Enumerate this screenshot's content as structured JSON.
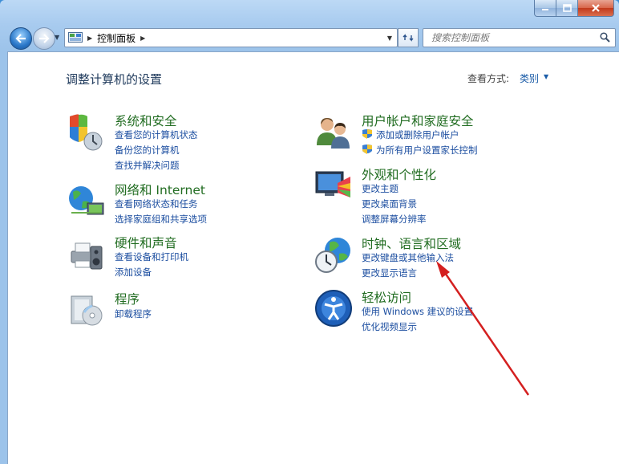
{
  "window": {
    "colors": {
      "accent": "#1c4ea0",
      "category_title": "#226d22",
      "annotation_arrow": "#d42020"
    }
  },
  "caption": {
    "minimize": "minimize",
    "maximize": "maximize",
    "close": "close"
  },
  "address": {
    "location": "控制面板",
    "icon": "control-panel-icon"
  },
  "search": {
    "placeholder": "搜索控制面板"
  },
  "header": {
    "title": "调整计算机的设置",
    "view_by_label": "查看方式:",
    "view_by_value": "类别"
  },
  "categories": {
    "system": {
      "title": "系统和安全",
      "links": [
        "查看您的计算机状态",
        "备份您的计算机",
        "查找并解决问题"
      ]
    },
    "network": {
      "title": "网络和 Internet",
      "links": [
        "查看网络状态和任务",
        "选择家庭组和共享选项"
      ]
    },
    "hardware": {
      "title": "硬件和声音",
      "links": [
        "查看设备和打印机",
        "添加设备"
      ]
    },
    "programs": {
      "title": "程序",
      "links": [
        "卸载程序"
      ]
    },
    "accounts": {
      "title": "用户帐户和家庭安全",
      "links": [
        "添加或删除用户帐户",
        "为所有用户设置家长控制"
      ]
    },
    "appearance": {
      "title": "外观和个性化",
      "links": [
        "更改主题",
        "更改桌面背景",
        "调整屏幕分辨率"
      ]
    },
    "clock": {
      "title": "时钟、语言和区域",
      "links": [
        "更改键盘或其他输入法",
        "更改显示语言"
      ]
    },
    "ease": {
      "title": "轻松访问",
      "links": [
        "使用 Windows 建议的设置",
        "优化视频显示"
      ]
    }
  }
}
